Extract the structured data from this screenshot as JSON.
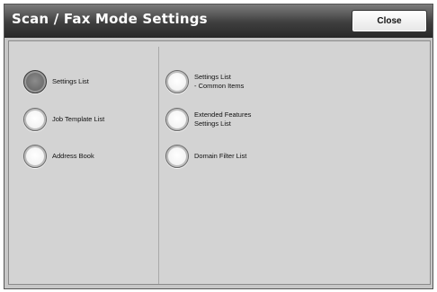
{
  "header": {
    "title": "Scan / Fax Mode Settings",
    "close_label": "Close"
  },
  "left_options": [
    {
      "label": "Settings List",
      "selected": true
    },
    {
      "label": "Job Template List",
      "selected": false
    },
    {
      "label": "Address Book",
      "selected": false
    }
  ],
  "right_options": [
    {
      "label": "Settings List\n- Common Items",
      "selected": false
    },
    {
      "label": "Extended Features\nSettings List",
      "selected": false
    },
    {
      "label": "Domain Filter List",
      "selected": false
    }
  ]
}
